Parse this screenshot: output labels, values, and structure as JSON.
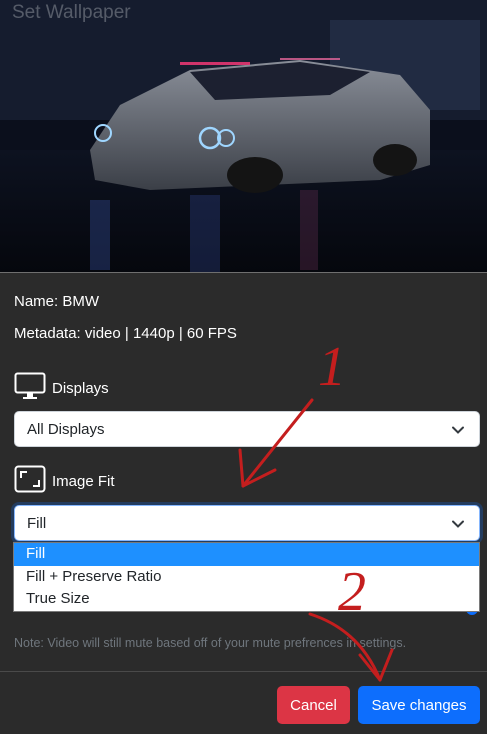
{
  "dialog": {
    "title": "Set Wallpaper"
  },
  "info": {
    "name": "Name: BMW",
    "metadata": "Metadata: video | 1440p | 60 FPS"
  },
  "displays": {
    "label": "Displays",
    "icon": "monitor-icon",
    "selected": "All Displays"
  },
  "image_fit": {
    "label": "Image Fit",
    "icon": "fullscreen-corners-icon",
    "selected": "Fill",
    "options": [
      "Fill",
      "Fill + Preserve Ratio",
      "True Size"
    ]
  },
  "volume_slider": {
    "value": 1.0
  },
  "note": "Note: Video will still mute based off of your mute prefrences in settings.",
  "footer": {
    "cancel_label": "Cancel",
    "save_label": "Save changes"
  },
  "annotations": {
    "step1": "1",
    "step2": "2"
  },
  "colors": {
    "accent": "#0d6efd",
    "danger": "#dc3545",
    "annotation": "#c41e1e",
    "background": "#2b2b2b"
  }
}
